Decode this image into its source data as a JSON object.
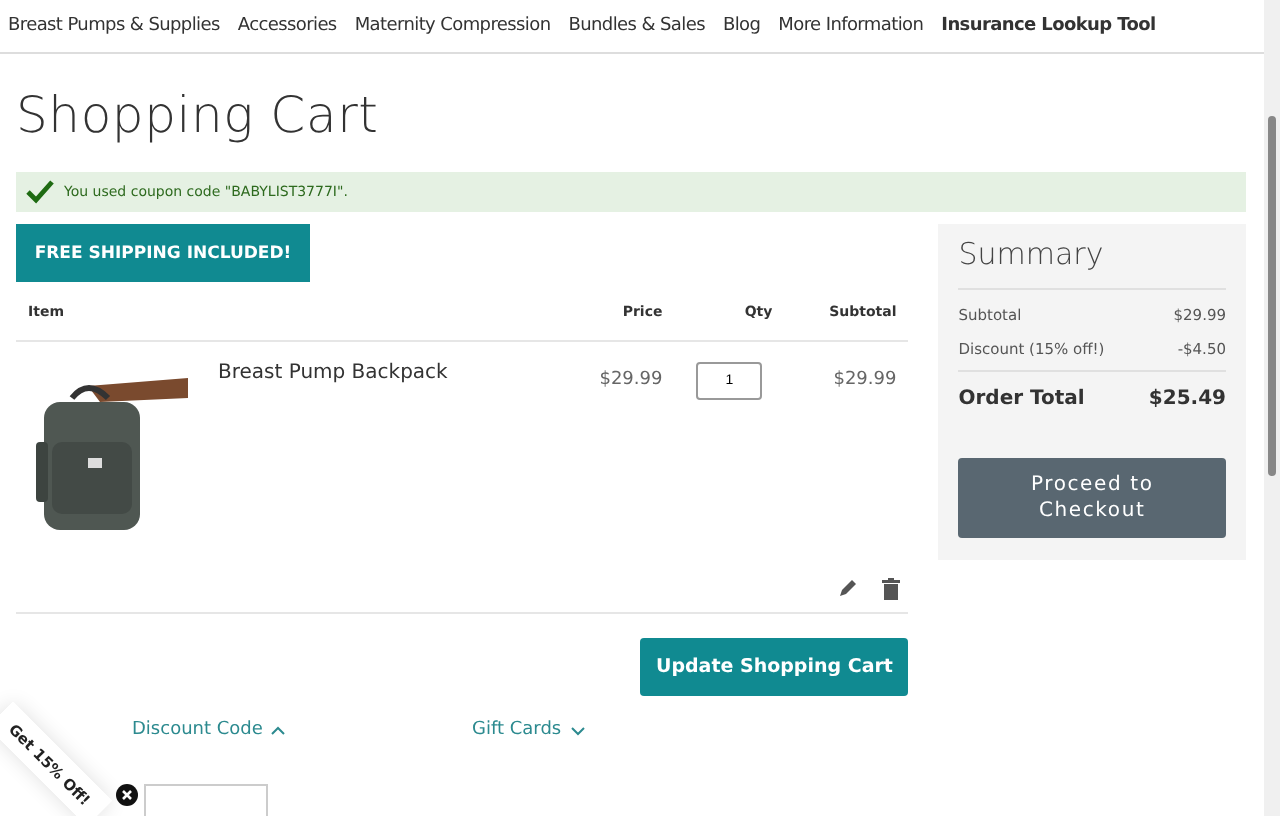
{
  "nav": [
    {
      "label": "Breast Pumps & Supplies",
      "selected": false
    },
    {
      "label": "Accessories",
      "selected": false
    },
    {
      "label": "Maternity Compression",
      "selected": false
    },
    {
      "label": "Bundles & Sales",
      "selected": false
    },
    {
      "label": "Blog",
      "selected": false
    },
    {
      "label": "More Information",
      "selected": false
    },
    {
      "label": "Insurance Lookup Tool",
      "selected": true
    }
  ],
  "title": "Shopping Cart",
  "coupon_message": "You used coupon code \"BABYLIST3777I\".",
  "banner": "FREE SHIPPING INCLUDED!",
  "table": {
    "columns": [
      "Item",
      "Price",
      "Qty",
      "Subtotal"
    ],
    "rows": [
      {
        "name": "Breast Pump Backpack",
        "price": "$29.99",
        "qty": "1",
        "subtotal": "$29.99"
      }
    ]
  },
  "update_button": "Update Shopping Cart",
  "sections": [
    {
      "label": "Discount Code",
      "expanded": true
    },
    {
      "label": "Gift Cards",
      "expanded": false
    }
  ],
  "summary": {
    "title": "Summary",
    "lines": [
      {
        "label": "Subtotal",
        "value": "$29.99"
      },
      {
        "label": "Discount (15% off!)",
        "value": "-$4.50"
      }
    ],
    "total_label": "Order Total",
    "total_value": "$25.49",
    "checkout": "Proceed to Checkout"
  },
  "promo_tab": "Get 15% Off!"
}
